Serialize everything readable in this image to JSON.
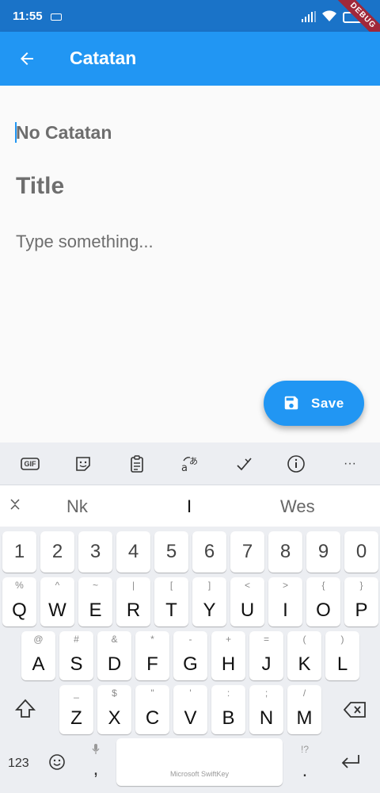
{
  "status": {
    "time": "11:55",
    "debug": "DEBUG"
  },
  "appbar": {
    "title": "Catatan"
  },
  "form": {
    "no_placeholder": "No Catatan",
    "title_placeholder": "Title",
    "body_placeholder": "Type something..."
  },
  "fab": {
    "label": "Save"
  },
  "keyboard": {
    "toolbar": [
      "gif-icon",
      "sticker-icon",
      "clipboard-icon",
      "translate-icon",
      "edit-icon",
      "info-icon",
      "more-icon"
    ],
    "toolbar_gif": "GIF",
    "toolbar_more": "···",
    "suggestions": [
      "Nk",
      "I",
      "Wes"
    ],
    "numbers": [
      "1",
      "2",
      "3",
      "4",
      "5",
      "6",
      "7",
      "8",
      "9",
      "0"
    ],
    "row1": [
      {
        "k": "Q",
        "s": "%"
      },
      {
        "k": "W",
        "s": "^"
      },
      {
        "k": "E",
        "s": "~"
      },
      {
        "k": "R",
        "s": "|"
      },
      {
        "k": "T",
        "s": "["
      },
      {
        "k": "Y",
        "s": "]"
      },
      {
        "k": "U",
        "s": "<"
      },
      {
        "k": "I",
        "s": ">"
      },
      {
        "k": "O",
        "s": "{"
      },
      {
        "k": "P",
        "s": "}"
      }
    ],
    "row2": [
      {
        "k": "A",
        "s": "@"
      },
      {
        "k": "S",
        "s": "#"
      },
      {
        "k": "D",
        "s": "&"
      },
      {
        "k": "F",
        "s": "*"
      },
      {
        "k": "G",
        "s": "-"
      },
      {
        "k": "H",
        "s": "+"
      },
      {
        "k": "J",
        "s": "="
      },
      {
        "k": "K",
        "s": "("
      },
      {
        "k": "L",
        "s": ")"
      }
    ],
    "row3": [
      {
        "k": "Z",
        "s": "_"
      },
      {
        "k": "X",
        "s": "$"
      },
      {
        "k": "C",
        "s": "\""
      },
      {
        "k": "V",
        "s": "'"
      },
      {
        "k": "B",
        "s": ":"
      },
      {
        "k": "N",
        "s": ";"
      },
      {
        "k": "M",
        "s": "/"
      }
    ],
    "sym_label": "123",
    "comma": ",",
    "period": ".",
    "period_sup": "!?",
    "space_brand": "Microsoft SwiftKey"
  },
  "colors": {
    "appbar": "#2196f3",
    "statusbar": "#1a73c8",
    "fab": "#2196f3"
  }
}
